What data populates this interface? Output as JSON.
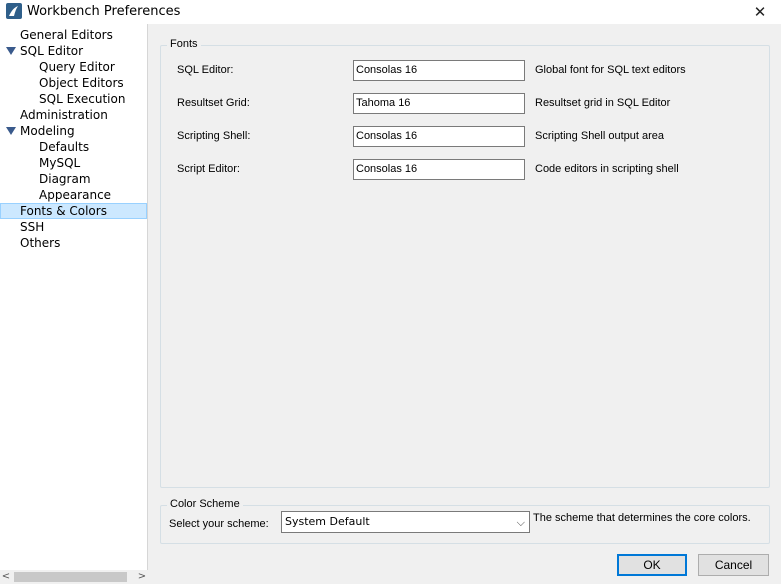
{
  "window": {
    "title": "Workbench Preferences",
    "icon": "workbench-dolphin-icon",
    "close_glyph": "✕"
  },
  "sidebar": {
    "items": [
      {
        "label": "General Editors",
        "level": 0
      },
      {
        "label": "SQL Editor",
        "level": 0,
        "expanded": true
      },
      {
        "label": "Query Editor",
        "level": 1
      },
      {
        "label": "Object Editors",
        "level": 1
      },
      {
        "label": "SQL Execution",
        "level": 1
      },
      {
        "label": "Administration",
        "level": 0
      },
      {
        "label": "Modeling",
        "level": 0,
        "expanded": true
      },
      {
        "label": "Defaults",
        "level": 1
      },
      {
        "label": "MySQL",
        "level": 1
      },
      {
        "label": "Diagram",
        "level": 1
      },
      {
        "label": "Appearance",
        "level": 1
      },
      {
        "label": "Fonts & Colors",
        "level": 0,
        "selected": true
      },
      {
        "label": "SSH",
        "level": 0
      },
      {
        "label": "Others",
        "level": 0
      }
    ],
    "scroll_left": "<",
    "scroll_right": ">"
  },
  "fonts": {
    "title": "Fonts",
    "rows": [
      {
        "label": "SQL Editor:",
        "value": "Consolas 16",
        "desc": "Global font for SQL text editors"
      },
      {
        "label": "Resultset Grid:",
        "value": "Tahoma 16",
        "desc": "Resultset grid in SQL Editor"
      },
      {
        "label": "Scripting Shell:",
        "value": "Consolas 16",
        "desc": "Scripting Shell output area"
      },
      {
        "label": "Script Editor:",
        "value": "Consolas 16",
        "desc": "Code editors in scripting shell"
      }
    ]
  },
  "scheme": {
    "title": "Color Scheme",
    "label": "Select your scheme:",
    "selected": "System Default",
    "chevron": "⌵",
    "desc": "The scheme that determines the core colors."
  },
  "buttons": {
    "ok": "OK",
    "cancel": "Cancel"
  },
  "colors": {
    "selection_bg": "#cce8ff",
    "selection_border": "#99d1ff",
    "ok_border": "#0078d7"
  }
}
